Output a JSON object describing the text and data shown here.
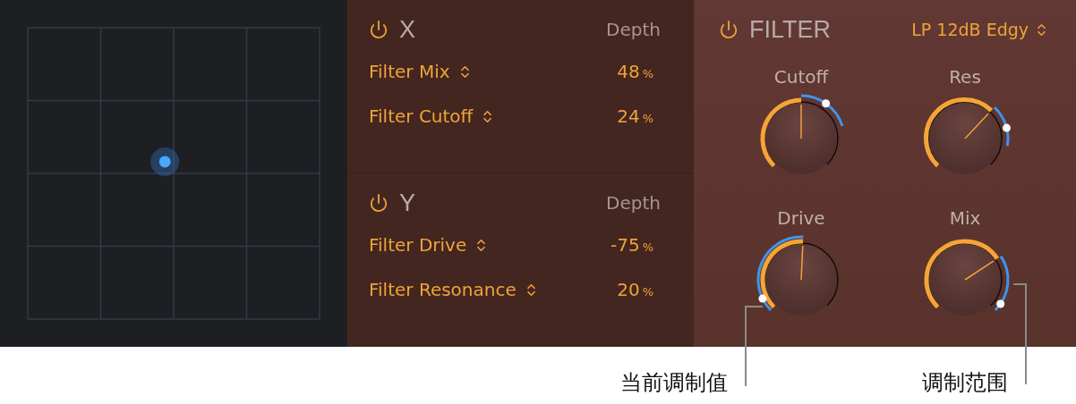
{
  "modulators": [
    {
      "name": "X",
      "on": true,
      "depth_label": "Depth",
      "targets": [
        {
          "name": "Filter Mix",
          "value": "48",
          "unit": "%"
        },
        {
          "name": "Filter Cutoff",
          "value": "24",
          "unit": "%"
        }
      ]
    },
    {
      "name": "Y",
      "on": true,
      "depth_label": "Depth",
      "targets": [
        {
          "name": "Filter Drive",
          "value": "-75",
          "unit": "%"
        },
        {
          "name": "Filter Resonance",
          "value": "20",
          "unit": "%"
        }
      ]
    }
  ],
  "filter": {
    "title": "FILTER",
    "on": true,
    "type": "LP 12dB Edgy",
    "knobs": [
      {
        "label": "Cutoff"
      },
      {
        "label": "Res"
      },
      {
        "label": "Drive"
      },
      {
        "label": "Mix"
      }
    ]
  },
  "callouts": [
    {
      "text": "当前调制值"
    },
    {
      "text": "调制范围"
    }
  ]
}
